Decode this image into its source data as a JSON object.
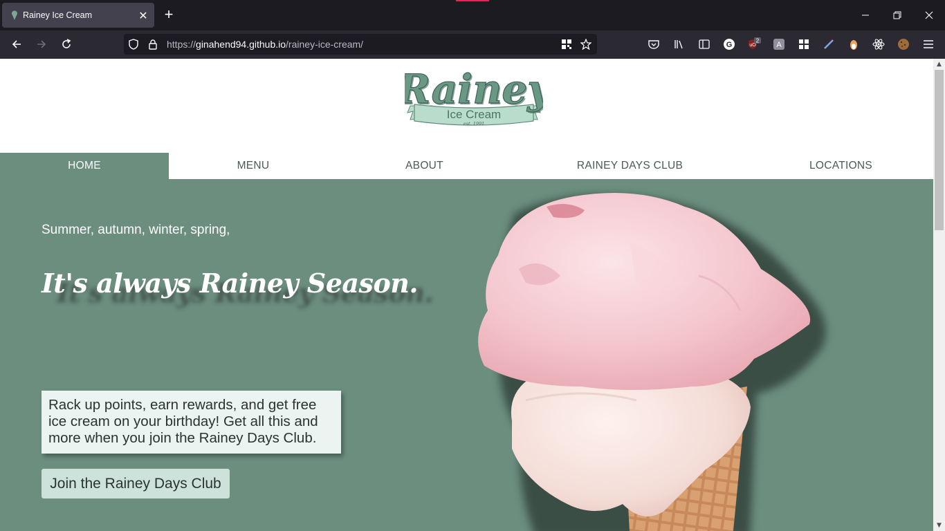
{
  "browser": {
    "tab": {
      "title": "Rainey Ice Cream",
      "favicon": "ice-cream-favicon"
    },
    "new_tab_label": "+",
    "window_controls": {
      "minimize": "—",
      "restore": "❐",
      "close": "✕"
    },
    "url": {
      "scheme": "https://",
      "host": "ginahend94.github.io",
      "path": "/rainey-ice-cream/"
    },
    "extension_badge": "2",
    "toolbar_icons": [
      "pocket-icon",
      "library-icon",
      "sidebar-icon",
      "grammarly-icon",
      "ublock-icon",
      "extension-icon",
      "extensions-grid-icon",
      "color-picker-icon",
      "fox-extension-icon",
      "react-devtools-icon",
      "cookie-icon",
      "menu-icon"
    ]
  },
  "site": {
    "logo": {
      "name": "Rainey",
      "sub": "Ice Cream",
      "est": "est. 1991"
    },
    "nav": [
      {
        "label": "HOME",
        "active": true
      },
      {
        "label": "MENU",
        "active": false
      },
      {
        "label": "ABOUT",
        "active": false
      },
      {
        "label": "RAINEY DAYS CLUB",
        "active": false
      },
      {
        "label": "LOCATIONS",
        "active": false
      }
    ],
    "hero": {
      "tagline": "Summer, autumn, winter, spring,",
      "headline": "It's always Rainey Season.",
      "promo": "Rack up points, earn rewards, and get free ice cream on your birthday! Get all this and more when you join the Rainey Days Club.",
      "cta": "Join the Rainey Days Club"
    },
    "colors": {
      "brand_green": "#6b8e7f",
      "logo_green": "#5e8a78",
      "ribbon": "#b9dccd",
      "cta_bg": "#cde2da"
    }
  }
}
